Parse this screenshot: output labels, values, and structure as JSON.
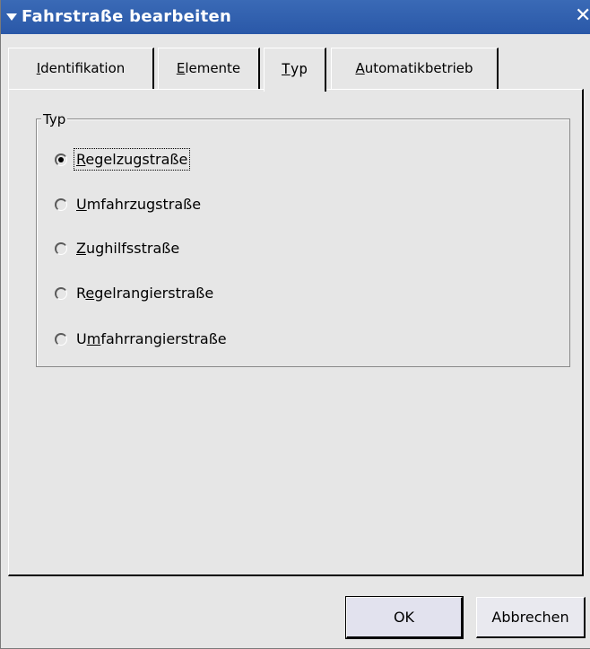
{
  "window": {
    "title": "Fahrstraße bearbeiten",
    "close_glyph": "✕"
  },
  "tabs": [
    {
      "label": "Identifikation",
      "mnemonic": "I",
      "rest": "dentifikation",
      "active": false
    },
    {
      "label": "Elemente",
      "mnemonic": "E",
      "rest": "lemente",
      "active": false
    },
    {
      "label": "Typ",
      "mnemonic": "T",
      "rest": "yp",
      "active": true
    },
    {
      "label": "Automatikbetrieb",
      "mnemonic": "A",
      "rest": "utomatikbetrieb",
      "active": false
    }
  ],
  "group": {
    "title": "Typ",
    "options": [
      {
        "label": "Regelzugstraße",
        "pre": "",
        "mnemonic": "R",
        "post": "egelzugstraße",
        "checked": true
      },
      {
        "label": "Umfahrzugstraße",
        "pre": "",
        "mnemonic": "U",
        "post": "mfahrzugstraße",
        "checked": false
      },
      {
        "label": "Zughilfsstraße",
        "pre": "",
        "mnemonic": "Z",
        "post": "ughilfsstraße",
        "checked": false
      },
      {
        "label": "Regelrangierstraße",
        "pre": "R",
        "mnemonic": "e",
        "post": "gelrangierstraße",
        "checked": false
      },
      {
        "label": "Umfahrrangierstraße",
        "pre": "U",
        "mnemonic": "m",
        "post": "fahrrangierstraße",
        "checked": false
      }
    ]
  },
  "buttons": {
    "ok": "OK",
    "cancel": "Abbrechen"
  }
}
